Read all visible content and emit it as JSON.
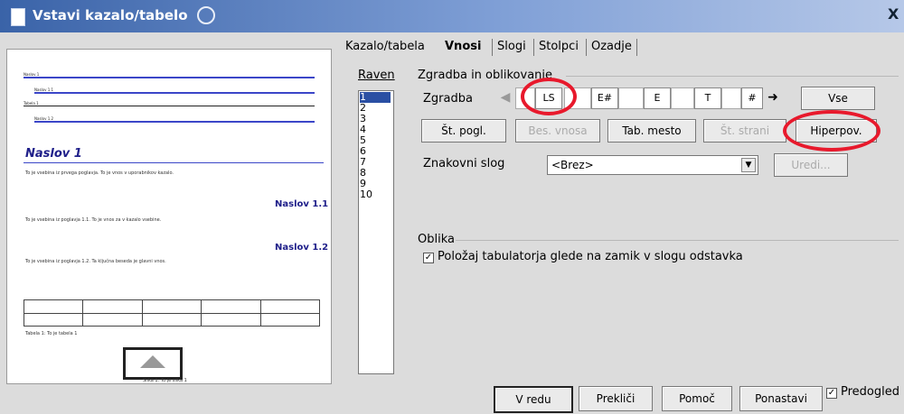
{
  "window": {
    "title": "Vstavi kazalo/tabelo",
    "close_glyph": "X"
  },
  "tabs": [
    {
      "label": "Kazalo/tabela",
      "active": false
    },
    {
      "label": "Vnosi",
      "active": true
    },
    {
      "label": "Slogi",
      "active": false
    },
    {
      "label": "Stolpci",
      "active": false
    },
    {
      "label": "Ozadje",
      "active": false
    }
  ],
  "level": {
    "label": "Raven",
    "items": [
      "1",
      "2",
      "3",
      "4",
      "5",
      "6",
      "7",
      "8",
      "9",
      "10"
    ],
    "selected": "1"
  },
  "structure": {
    "group_label": "Zgradba in oblikovanje",
    "row_label": "Zgradba",
    "tokens": {
      "ls": "LS",
      "e_hash": "E#",
      "e": "E",
      "t": "T",
      "hash": "#"
    },
    "all_button": "Vse",
    "buttons": {
      "chapter": "Št. pogl.",
      "entry_text": "Bes. vnosa",
      "tab_stop": "Tab. mesto",
      "page_no": "Št. strani",
      "hyperlink": "Hiperpov."
    },
    "char_style_label": "Znakovni slog",
    "char_style_value": "<Brez>",
    "edit_button": "Uredi..."
  },
  "format": {
    "group_label": "Oblika",
    "checkbox_label": "Položaj tabulatorja glede na zamik v slogu odstavka",
    "checked": true
  },
  "footer": {
    "ok": "V redu",
    "cancel": "Prekliči",
    "help": "Pomoč",
    "reset": "Ponastavi",
    "preview_checkbox": "Predogled",
    "preview_checked": true
  },
  "preview": {
    "heading1": "Naslov 1",
    "heading11": "Naslov 1.1",
    "heading12": "Naslov 1.2",
    "toc_lines": [
      "Naslov 1",
      "Naslov 1.1",
      "Tabela 1",
      "Naslov 1.2"
    ],
    "para1": "To je vsebina iz prvega poglavja. To je vnos v uporabnikov kazalo.",
    "para11": "To je vsebina iz poglavja 1.1. To je vnos za v kazalo vsebine.",
    "para12": "To je vsebina iz poglavja 1.2. Ta ključna beseda je glavni vnos.",
    "table_caption": "Tabela 1: To je tabela 1",
    "image_caption": "Slika 1: To je slika 1"
  },
  "colors": {
    "highlight": "#e8192c",
    "selection": "#2a4fa3",
    "heading": "#20208a"
  }
}
